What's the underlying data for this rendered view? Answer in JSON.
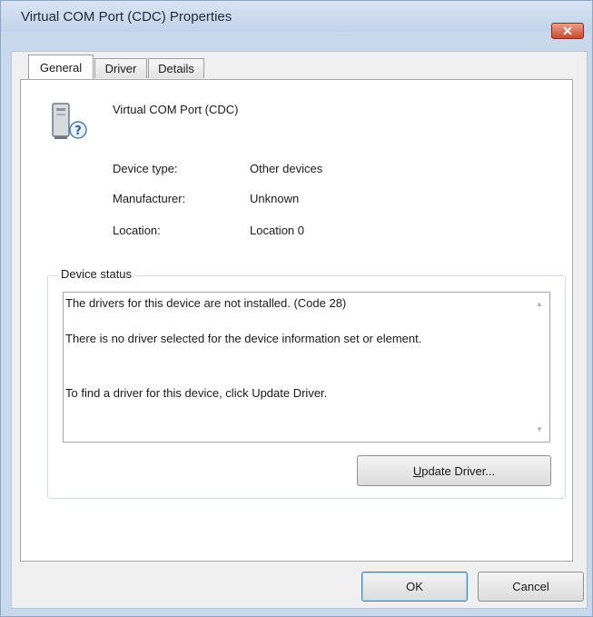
{
  "window": {
    "title": "Virtual COM Port (CDC) Properties",
    "close_glyph": "✕"
  },
  "tabs": [
    {
      "label": "General",
      "active": true
    },
    {
      "label": "Driver",
      "active": false
    },
    {
      "label": "Details",
      "active": false
    }
  ],
  "device": {
    "icon": "device-unknown-icon",
    "name": "Virtual COM Port (CDC)",
    "properties": [
      {
        "label": "Device type:",
        "value": "Other devices"
      },
      {
        "label": "Manufacturer:",
        "value": "Unknown"
      },
      {
        "label": "Location:",
        "value": "Location 0"
      }
    ]
  },
  "status": {
    "group_title": "Device status",
    "lines": [
      "The drivers for this device are not installed. (Code 28)",
      "There is no driver selected for the device information set or element.",
      "To find a driver for this device, click Update Driver."
    ],
    "update_button": {
      "mnemonic": "U",
      "rest": "pdate Driver..."
    }
  },
  "buttons": {
    "ok": "OK",
    "cancel": "Cancel"
  },
  "colors": {
    "title_bar": "#c9d9ec",
    "close_button": "#c84a2c",
    "default_button_border": "#3c7fb1"
  }
}
